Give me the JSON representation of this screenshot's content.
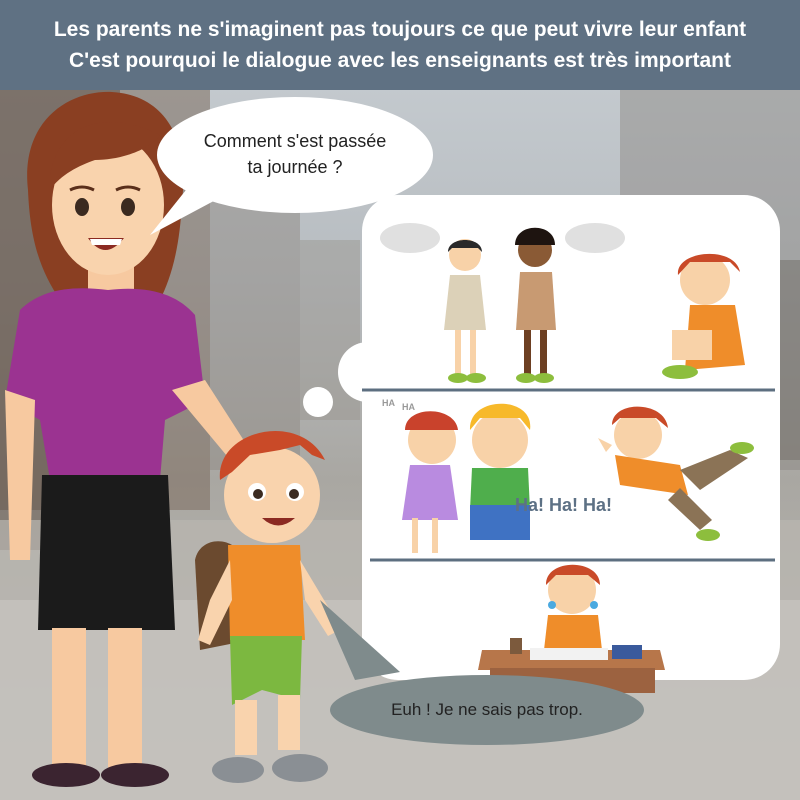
{
  "header": {
    "line1": "Les parents ne s'imaginent pas toujours ce que peut vivre leur enfant",
    "line2": "C'est pourquoi le dialogue avec les enseignants est très important"
  },
  "mother_speech": {
    "line1": "Comment s'est passée",
    "line2": "ta journée ?"
  },
  "child_speech": {
    "text": "Euh ! Je ne sais pas trop."
  },
  "thought_panels": {
    "laugh_text": "Ha! Ha! Ha!",
    "ha_small_1": "HA",
    "ha_small_2": "HA"
  },
  "colors": {
    "header_bg": "#5f7183",
    "header_text": "#ffffff",
    "child_bubble": "#7f8b8c",
    "thought_bubble": "#ffffff",
    "laugh_text": "#5d7185"
  }
}
